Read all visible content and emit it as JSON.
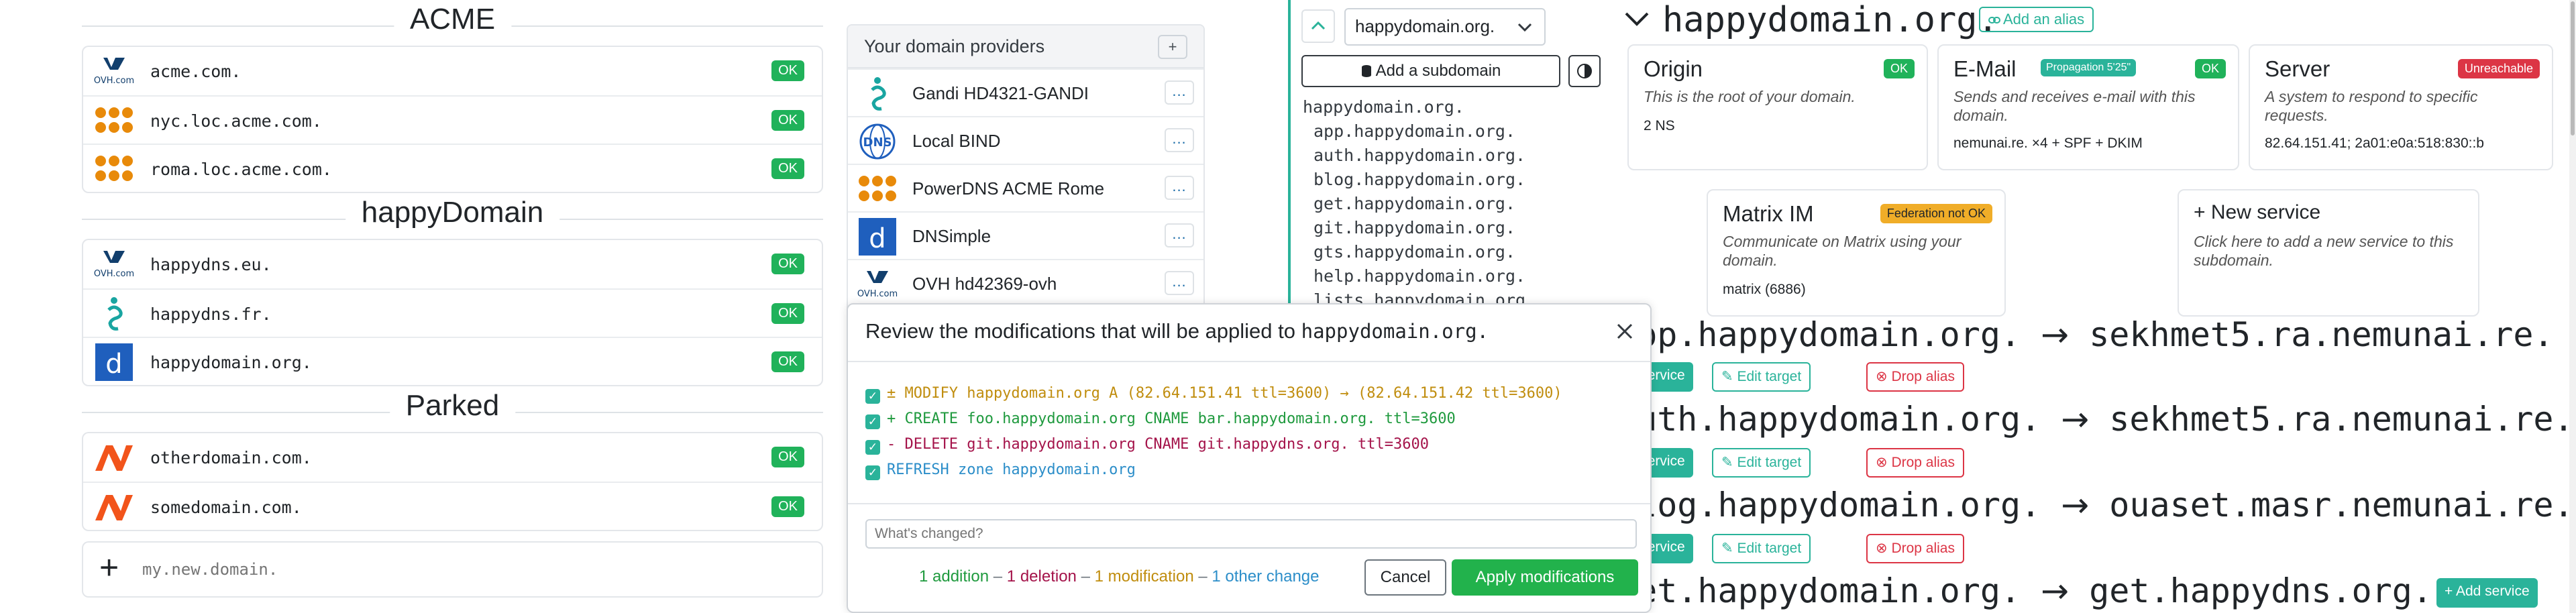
{
  "groups": [
    {
      "title": "ACME",
      "domains": [
        {
          "name": "acme.com.",
          "status": "OK",
          "provider_icon": "ovh-logo"
        },
        {
          "name": "nyc.loc.acme.com.",
          "status": "OK",
          "provider_icon": "powerdns-logo"
        },
        {
          "name": "roma.loc.acme.com.",
          "status": "OK",
          "provider_icon": "powerdns-logo"
        }
      ]
    },
    {
      "title": "happyDomain",
      "domains": [
        {
          "name": "happydns.eu.",
          "status": "OK",
          "provider_icon": "ovh-logo"
        },
        {
          "name": "happydns.fr.",
          "status": "OK",
          "provider_icon": "gandi-logo"
        },
        {
          "name": "happydomain.org.",
          "status": "OK",
          "provider_icon": "dnsimple-logo"
        }
      ]
    },
    {
      "title": "Parked",
      "domains": [
        {
          "name": "otherdomain.com.",
          "status": "OK",
          "provider_icon": "parked-logo"
        },
        {
          "name": "somedomain.com.",
          "status": "OK",
          "provider_icon": "parked-logo"
        }
      ]
    }
  ],
  "new_domain": {
    "plus": "+",
    "placeholder": "my.new.domain."
  },
  "providers": {
    "title": "Your domain providers",
    "add_label": "+",
    "more_label": "...",
    "items": [
      {
        "name": "Gandi HD4321-GANDI",
        "icon": "gandi-logo"
      },
      {
        "name": "Local BIND",
        "icon": "dns-logo"
      },
      {
        "name": "PowerDNS ACME Rome",
        "icon": "powerdns-logo"
      },
      {
        "name": "DNSimple",
        "icon": "dnsimple-logo"
      },
      {
        "name": "OVH hd42369-ovh",
        "icon": "ovh-logo"
      }
    ]
  },
  "zone_nav": {
    "selected": "happydomain.org.",
    "add_subdomain": "Add a subdomain",
    "root": "happydomain.org.",
    "subdomains": [
      "app.happydomain.org.",
      "auth.happydomain.org.",
      "blog.happydomain.org.",
      "get.happydomain.org.",
      "git.happydomain.org.",
      "gts.happydomain.org.",
      "help.happydomain.org.",
      "lists.happydomain.org."
    ]
  },
  "zone_view": {
    "title": "happydomain.org.",
    "add_alias": "Add an alias",
    "cards": {
      "origin": {
        "title": "Origin",
        "badge": "OK",
        "desc": "This is the root of your domain.",
        "value": "2 NS"
      },
      "email": {
        "title": "E-Mail",
        "badge1": "Propagation 5'25\"",
        "badge2": "OK",
        "desc": "Sends and receives e-mail with this domain.",
        "value": "nemunai.re. ×4 + SPF + DKIM"
      },
      "server": {
        "title": "Server",
        "badge": "Unreachable",
        "desc": "A system to respond to specific requests.",
        "value": "82.64.151.41; 2a01:e0a:518:830::b"
      },
      "matrix": {
        "title": "Matrix IM",
        "badge": "Federation not OK",
        "desc": "Communicate on Matrix using your domain.",
        "value": "matrix (6886)"
      },
      "new_service": {
        "title": "New service",
        "desc": "Click here to add a new service to this subdomain."
      }
    },
    "arrow": "→",
    "add_service": "Add service",
    "edit_target": "Edit target",
    "drop_alias": "Drop alias",
    "add_service_plus": "+ Add service",
    "aliases": [
      {
        "name": "app.happydomain.org.",
        "target": "sekhmet5.ra.nemunai.re."
      },
      {
        "name": "auth.happydomain.org.",
        "target": "sekhmet5.ra.nemunai.re."
      },
      {
        "name": "blog.happydomain.org.",
        "target": "ouaset.masr.nemunai.re."
      },
      {
        "name": "get.happydomain.org.",
        "target": "get.happydns.org."
      }
    ]
  },
  "modal": {
    "title_prefix": "Review the modifications that will be applied to",
    "zone": "happydomain.org.",
    "changes": [
      {
        "kind": "modify",
        "text": "± MODIFY happydomain.org A (82.64.151.41 ttl=3600) → (82.64.151.42 ttl=3600)"
      },
      {
        "kind": "add",
        "text": "+ CREATE foo.happydomain.org CNAME bar.happydomain.org. ttl=3600"
      },
      {
        "kind": "delete",
        "text": "- DELETE git.happydomain.org CNAME git.happydns.org. ttl=3600"
      },
      {
        "kind": "other",
        "text": "REFRESH zone happydomain.org"
      }
    ],
    "comment_placeholder": "What's changed?",
    "summary": {
      "additions": "1 addition",
      "deletions": "1 deletion",
      "modifications": "1 modification",
      "other": "1 other change",
      "sep": "–"
    },
    "cancel": "Cancel",
    "apply": "Apply modifications"
  },
  "colors": {
    "accent": "#2ab39a",
    "ok": "#20b25a",
    "danger": "#dc3545",
    "warning": "#f0ad28",
    "apply": "#22b24c"
  }
}
